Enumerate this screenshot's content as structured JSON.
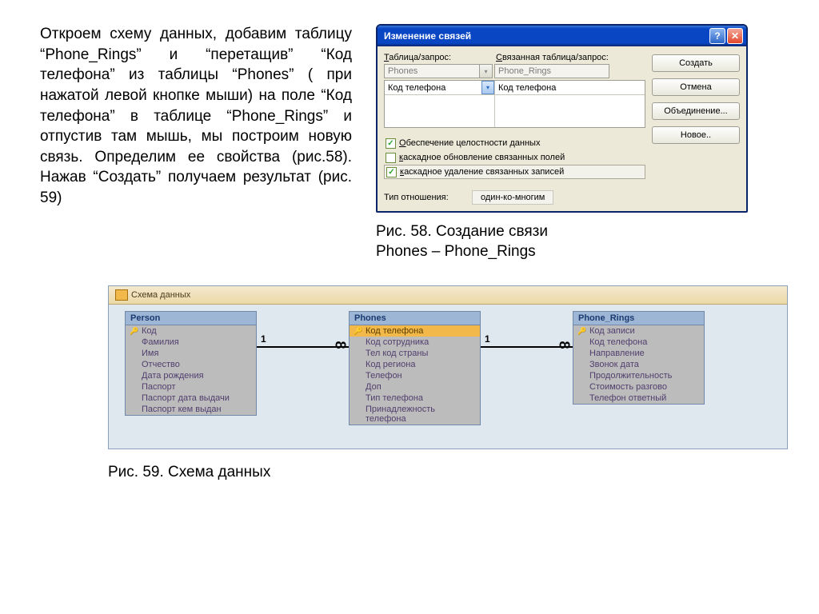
{
  "instructions_text": "Откроем схему данных, добавим таблицу “Phone_Rings” и “перетащив” “Код телефона” из таблицы “Phones” ( при нажатой левой кнопке мыши) на поле “Код телефона” в таблице “Phone_Rings” и отпустив там мышь, мы построим новую связь. Определим ее свойства (рис.58). Нажав “Создать” получаем результат (рис. 59)",
  "dialog": {
    "title": "Изменение связей",
    "label_table": "Таблица/запрос:",
    "label_related": "Связанная таблица/запрос:",
    "combo_table": "Phones",
    "combo_related": "Phone_Rings",
    "field_left": "Код телефона",
    "field_right": "Код телефона",
    "cb1": "Обеспечение целостности данных",
    "cb2": "каскадное обновление связанных полей",
    "cb3": "каскадное удаление связанных записей",
    "rel_label": "Тип отношения:",
    "rel_value": "один-ко-многим",
    "buttons": {
      "create": "Создать",
      "cancel": "Отмена",
      "join": "Объединение...",
      "new": "Новое.."
    }
  },
  "caption58_l1": "Рис. 58. Создание связи",
  "caption58_l2": "Phones – Phone_Rings",
  "schema": {
    "tab_label": "Схема данных",
    "tables": [
      {
        "name": "Person",
        "fields": [
          "Код",
          "Фамилия",
          "Имя",
          "Отчество",
          "Дата рождения",
          "Паспорт",
          "Паспорт дата выдачи",
          "Паспорт кем выдан"
        ],
        "key": 0,
        "sel": -1
      },
      {
        "name": "Phones",
        "fields": [
          "Код телефона",
          "Код сотрудника",
          "Тел код страны",
          "Код региона",
          "Телефон",
          "Доп",
          "Тип телефона",
          "Принадлежность телефона"
        ],
        "key": 0,
        "sel": 0
      },
      {
        "name": "Phone_Rings",
        "fields": [
          "Код записи",
          "Код телефона",
          "Направление",
          "Звонок дата",
          "Продолжительность",
          "Стоимость разгово",
          "Телефон ответный"
        ],
        "key": 0,
        "sel": -1
      }
    ],
    "rel_one": "1",
    "rel_many": "∞"
  },
  "caption59": "Рис. 59. Схема данных"
}
